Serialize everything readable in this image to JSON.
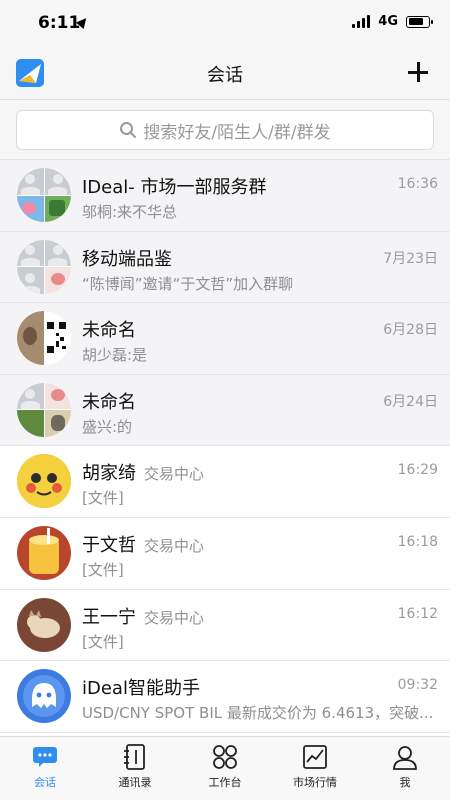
{
  "status_bar": {
    "time": "6:11",
    "network": "4G"
  },
  "header": {
    "title": "会话"
  },
  "search": {
    "placeholder": "搜索好友/陌生人/群/群发"
  },
  "chats": [
    {
      "name": "IDeal- 市场一部服务群",
      "tag": "",
      "time": "16:36",
      "message": "邬桐:来不华总",
      "type": "group"
    },
    {
      "name": "移动端品鉴",
      "tag": "",
      "time": "7月23日",
      "message": "“陈博闻”邀请“于文哲”加入群聊",
      "type": "group"
    },
    {
      "name": "未命名",
      "tag": "",
      "time": "6月28日",
      "message": "胡少磊:是",
      "type": "group"
    },
    {
      "name": "未命名",
      "tag": "",
      "time": "6月24日",
      "message": "盛兴:的",
      "type": "group"
    },
    {
      "name": "胡家绮",
      "tag": "交易中心",
      "time": "16:29",
      "message": "[文件]",
      "type": "person"
    },
    {
      "name": "于文哲",
      "tag": "交易中心",
      "time": "16:18",
      "message": "[文件]",
      "type": "person"
    },
    {
      "name": "王一宁",
      "tag": "交易中心",
      "time": "16:12",
      "message": "[文件]",
      "type": "person"
    },
    {
      "name": "iDeal智能助手",
      "tag": "",
      "time": "09:32",
      "message": "USD/CNY SPOT BIL 最新成交价为 6.4613，突破...",
      "type": "bot"
    }
  ],
  "tabs": [
    {
      "label": "会话",
      "icon": "chat-bubble-icon",
      "active": true
    },
    {
      "label": "通讯录",
      "icon": "contacts-book-icon",
      "active": false
    },
    {
      "label": "工作台",
      "icon": "workbench-grid-icon",
      "active": false
    },
    {
      "label": "市场行情",
      "icon": "market-chart-icon",
      "active": false
    },
    {
      "label": "我",
      "icon": "profile-icon",
      "active": false
    }
  ],
  "colors": {
    "accent": "#2f8ef0",
    "bar_bg": "#f6f6f7",
    "muted_text": "#8e8e93"
  }
}
